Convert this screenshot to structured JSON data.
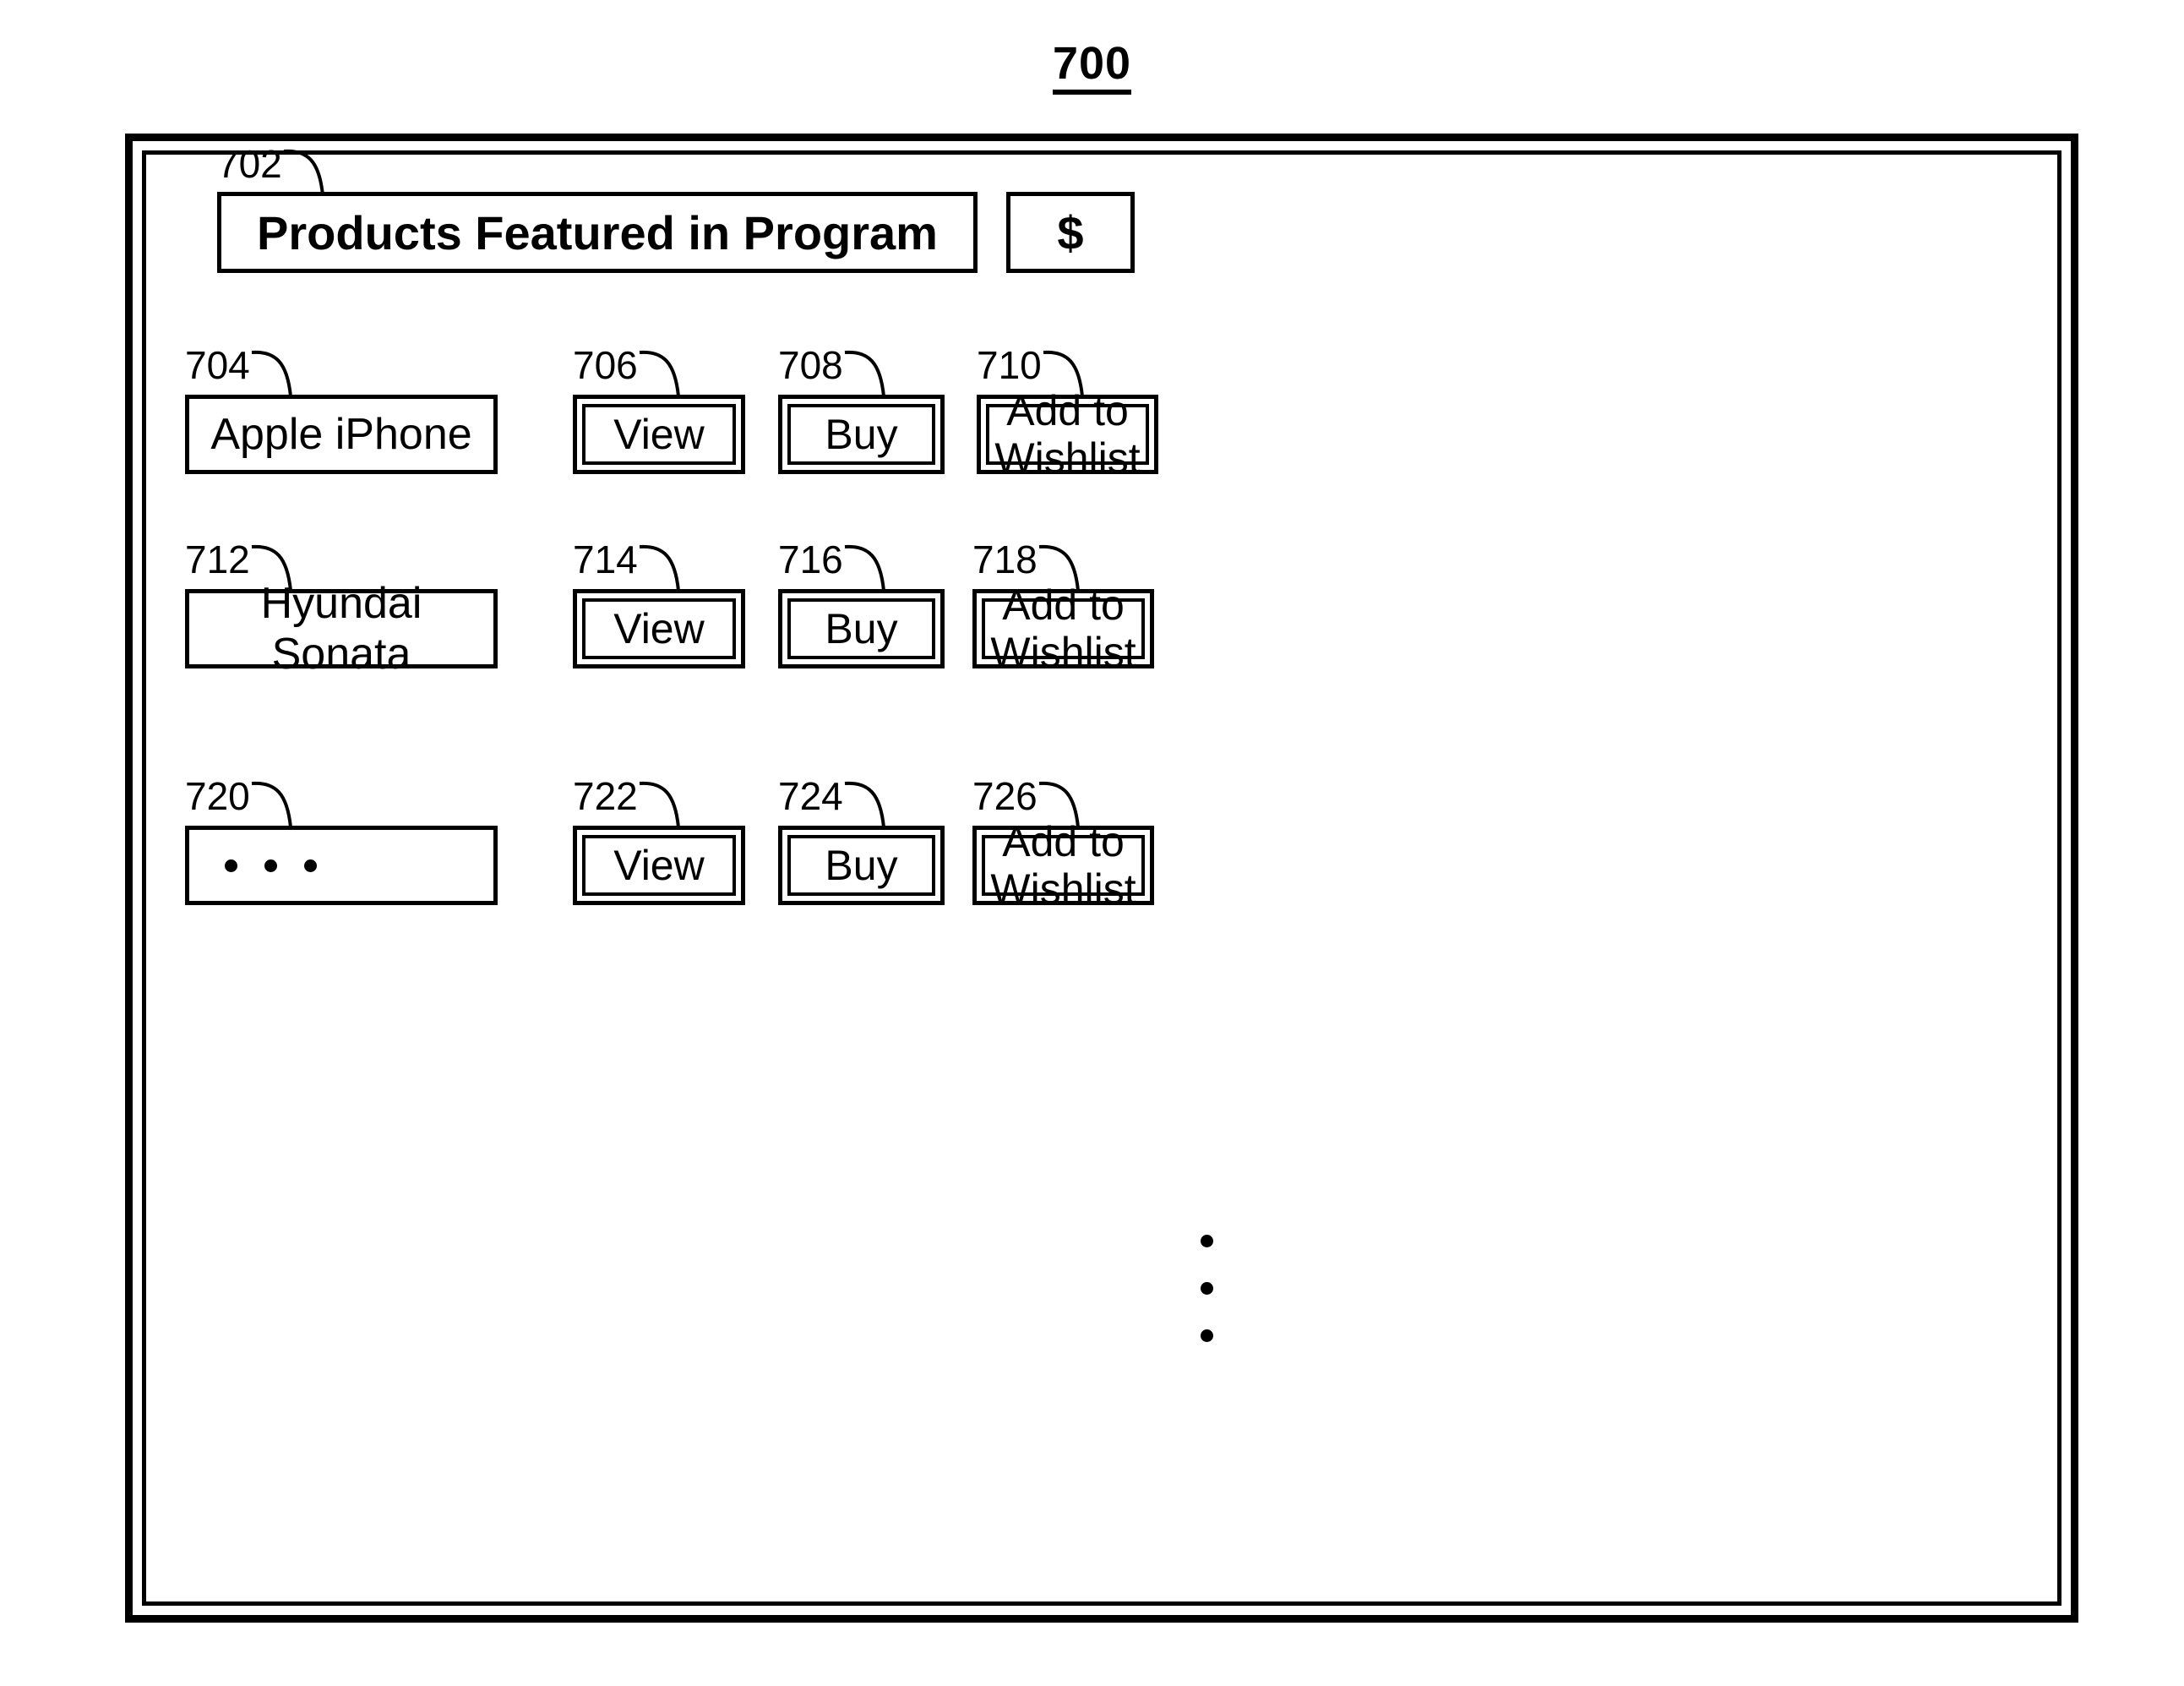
{
  "figure": {
    "number": "700"
  },
  "header": {
    "ref": "702",
    "title": "Products Featured in Program",
    "currency_button": {
      "label": "$",
      "icon": "dollar-sign-icon"
    }
  },
  "rows": [
    {
      "product": {
        "ref": "704",
        "label": "Apple iPhone"
      },
      "view": {
        "ref": "706",
        "label": "View"
      },
      "buy": {
        "ref": "708",
        "label": "Buy"
      },
      "wishlist": {
        "ref": "710",
        "label": "Add to Wishlist"
      }
    },
    {
      "product": {
        "ref": "712",
        "label": "Hyundai Sonata"
      },
      "view": {
        "ref": "714",
        "label": "View"
      },
      "buy": {
        "ref": "716",
        "label": "Buy"
      },
      "wishlist": {
        "ref": "718",
        "label": "Add to Wishlist"
      }
    },
    {
      "product": {
        "ref": "720",
        "label": "",
        "icon": "horizontal-ellipsis-icon"
      },
      "view": {
        "ref": "722",
        "label": "View"
      },
      "buy": {
        "ref": "724",
        "label": "Buy"
      },
      "wishlist": {
        "ref": "726",
        "label": "Add to Wishlist"
      }
    }
  ],
  "separator": {
    "icon": "vertical-ellipsis-icon"
  },
  "colors": {
    "line": "#000000",
    "background": "#ffffff"
  }
}
